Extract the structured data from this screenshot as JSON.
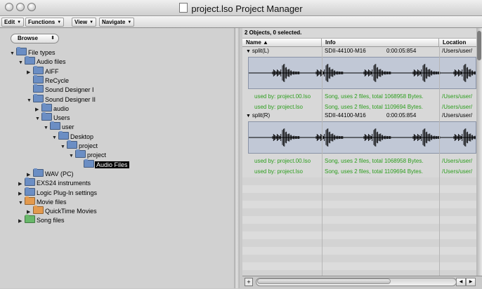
{
  "window": {
    "title": "project.lso Project Manager"
  },
  "menus": [
    {
      "label": "Edit"
    },
    {
      "label": "Functions"
    },
    {
      "label": "View"
    },
    {
      "label": "Navigate"
    }
  ],
  "browser": {
    "mode": "Browse",
    "tree": [
      {
        "label": "File types",
        "depth": 0,
        "expanded": true,
        "folder_color": "#6b8ec4"
      },
      {
        "label": "Audio files",
        "depth": 1,
        "expanded": true,
        "folder_color": "#6b8ec4"
      },
      {
        "label": "AIFF",
        "depth": 2,
        "expanded": false,
        "folder_color": "#6b8ec4"
      },
      {
        "label": "ReCycle",
        "depth": 2,
        "expanded": null,
        "folder_color": "#6b8ec4"
      },
      {
        "label": "Sound Designer I",
        "depth": 2,
        "expanded": null,
        "folder_color": "#6b8ec4"
      },
      {
        "label": "Sound Designer II",
        "depth": 2,
        "expanded": true,
        "folder_color": "#6b8ec4"
      },
      {
        "label": "audio",
        "depth": 3,
        "expanded": false,
        "folder_color": "#6b8ec4"
      },
      {
        "label": "Users",
        "depth": 3,
        "expanded": true,
        "folder_color": "#6b8ec4"
      },
      {
        "label": "user",
        "depth": 4,
        "expanded": true,
        "folder_color": "#6b8ec4"
      },
      {
        "label": "Desktop",
        "depth": 5,
        "expanded": true,
        "folder_color": "#6b8ec4"
      },
      {
        "label": "project",
        "depth": 6,
        "expanded": true,
        "folder_color": "#6b8ec4"
      },
      {
        "label": "project",
        "depth": 7,
        "expanded": true,
        "folder_color": "#6b8ec4"
      },
      {
        "label": "Audio Files",
        "depth": 8,
        "expanded": null,
        "folder_color": "#6b8ec4",
        "selected": true
      },
      {
        "label": "WAV (PC)",
        "depth": 2,
        "expanded": false,
        "folder_color": "#6b8ec4"
      },
      {
        "label": "EXS24 instruments",
        "depth": 1,
        "expanded": false,
        "folder_color": "#6b8ec4"
      },
      {
        "label": "Logic Plug-In settings",
        "depth": 1,
        "expanded": false,
        "folder_color": "#6b8ec4"
      },
      {
        "label": "Movie files",
        "depth": 1,
        "expanded": true,
        "folder_color": "#e39a4e"
      },
      {
        "label": "QuickTime Movies",
        "depth": 2,
        "expanded": false,
        "folder_color": "#e39a4e"
      },
      {
        "label": "Song files",
        "depth": 1,
        "expanded": false,
        "folder_color": "#69b86a"
      }
    ]
  },
  "list": {
    "status": "2 Objects, 0 selected.",
    "columns": [
      {
        "label": "Name ▲"
      },
      {
        "label": "Info"
      },
      {
        "label": "Location"
      }
    ],
    "objects": [
      {
        "name": "split(L)",
        "format": "SDII-44100-M16",
        "duration": "0:00:05:854",
        "location": "/Users/user/",
        "usages": [
          {
            "used_by": "used by: project.00.lso",
            "info": "Song, uses 2 files, total 1068958 Bytes.",
            "location": "/Users/user/"
          },
          {
            "used_by": "used by: project.lso",
            "info": "Song, uses 2 files, total 1109694 Bytes.",
            "location": "/Users/user/"
          }
        ]
      },
      {
        "name": "split(R)",
        "format": "SDII-44100-M16",
        "duration": "0:00:05:854",
        "location": "/Users/user/",
        "usages": [
          {
            "used_by": "used by: project.00.lso",
            "info": "Song, uses 2 files, total 1068958 Bytes.",
            "location": "/Users/user/"
          },
          {
            "used_by": "used by: project.lso",
            "info": "Song, uses 2 files, total 1109694 Bytes.",
            "location": "/Users/user/"
          }
        ]
      }
    ]
  },
  "colors": {
    "used_by_text": "#2d9e1e",
    "selection": "#000000",
    "waveform_bg": "#c1c8d6"
  }
}
